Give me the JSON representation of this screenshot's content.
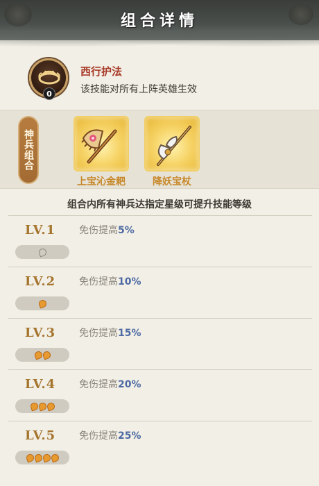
{
  "header": {
    "title": "组合详情"
  },
  "skill": {
    "name": "西行护法",
    "description": "该技能对所有上阵英雄生效",
    "level_badge": "0",
    "icon": "headband-icon"
  },
  "weapons": {
    "tag": "神兵组合",
    "items": [
      {
        "name": "上宝沁金耙",
        "icon": "rake-icon"
      },
      {
        "name": "降妖宝杖",
        "icon": "staff-icon"
      }
    ]
  },
  "rule": "组合内所有神兵达指定星级可提升技能等级",
  "levels": [
    {
      "name": "LV.1",
      "effect_label": "免伤提高",
      "effect_value": "5%",
      "stars": 1,
      "filled": 0
    },
    {
      "name": "LV.2",
      "effect_label": "免伤提高",
      "effect_value": "10%",
      "stars": 1,
      "filled": 1
    },
    {
      "name": "LV.3",
      "effect_label": "免伤提高",
      "effect_value": "15%",
      "stars": 2,
      "filled": 2
    },
    {
      "name": "LV.4",
      "effect_label": "免伤提高",
      "effect_value": "20%",
      "stars": 3,
      "filled": 3
    },
    {
      "name": "LV.5",
      "effect_label": "免伤提高",
      "effect_value": "25%",
      "stars": 4,
      "filled": 4
    }
  ],
  "colors": {
    "skill_name": "#a83a28",
    "level_name": "#a5752e",
    "effect_value": "#4d6aa3",
    "weapon_label": "#c7882a"
  }
}
